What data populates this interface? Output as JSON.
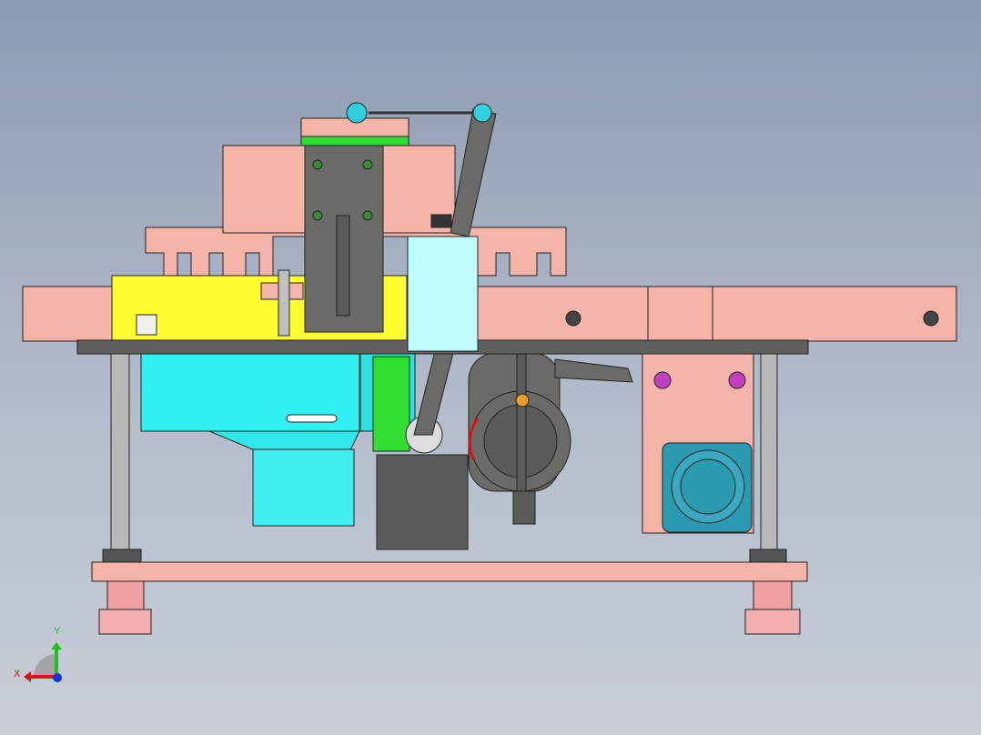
{
  "viewport": {
    "background_top": "#8c9bb1",
    "background_bottom": "#c9ced7"
  },
  "triad": {
    "x_label": "X",
    "y_label": "Y",
    "x_color": "#e01010",
    "y_color": "#20c020",
    "z_color": "#1030e0"
  },
  "colors": {
    "pink": "#f4b4a8",
    "yellow": "#ffff30",
    "cyan": "#30f0f0",
    "green": "#20e020",
    "dark_gray": "#6a6a66",
    "light_cyan": "#c0ffff",
    "teal": "#2a9bb0"
  }
}
